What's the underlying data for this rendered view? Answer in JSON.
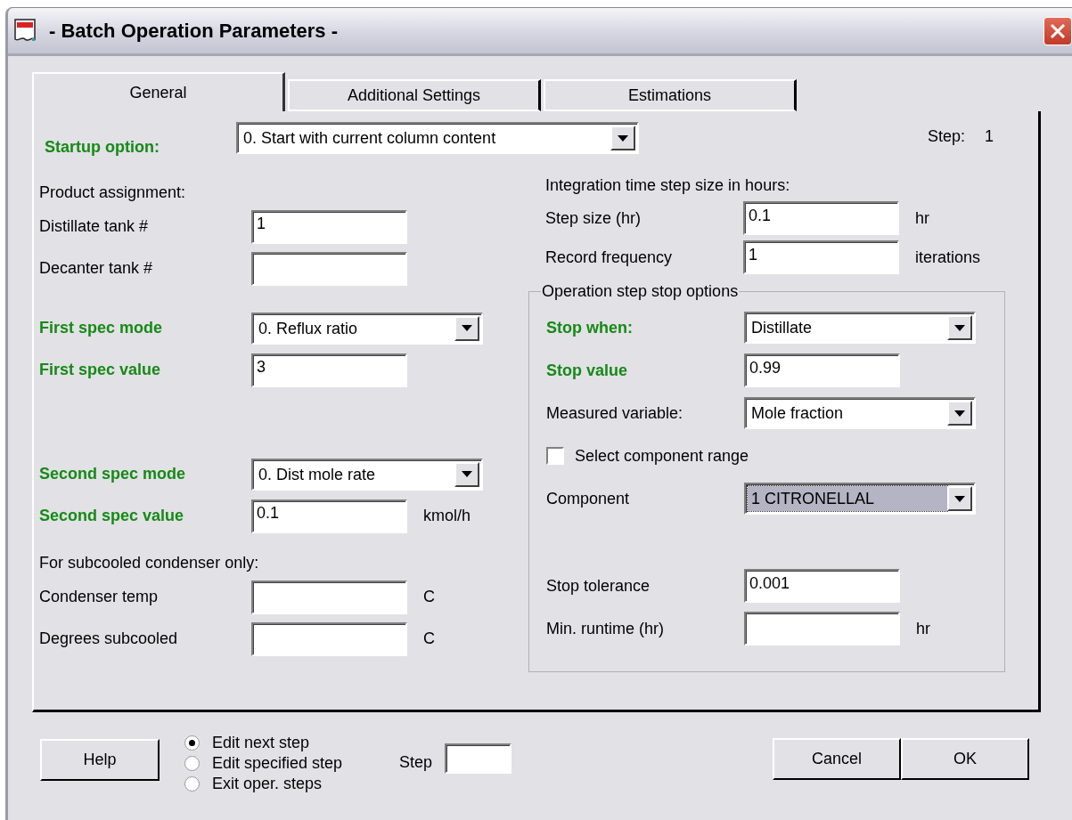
{
  "window": {
    "title": "- Batch Operation Parameters  -"
  },
  "tabs": [
    {
      "label": "General",
      "selected": true
    },
    {
      "label": "Additional Settings",
      "selected": false
    },
    {
      "label": "Estimations",
      "selected": false
    }
  ],
  "startup": {
    "label": "Startup option:",
    "value": "0. Start with current column content",
    "emphasized": true
  },
  "step_indicator": {
    "label": "Step:",
    "value": "1"
  },
  "left_groups": [
    {
      "heading": "Product assignment:",
      "rows": [
        {
          "kind": "field",
          "label": "Distillate tank #",
          "value": "1",
          "emphasized": false
        },
        {
          "kind": "field",
          "label": "Decanter tank #",
          "emphasized": false
        }
      ]
    },
    {
      "rows": [
        {
          "kind": "dropdown",
          "label": "First spec mode",
          "value": "0.  Reflux ratio",
          "emphasized": true,
          "focused": false
        },
        {
          "kind": "field",
          "label": "First spec value",
          "value": "3",
          "emphasized": true
        }
      ]
    },
    {
      "rows": [
        {
          "kind": "dropdown",
          "label": "Second spec mode",
          "value": "0.  Dist mole rate",
          "emphasized": true,
          "focused": false
        },
        {
          "kind": "field",
          "label": "Second spec value",
          "value": "0.1",
          "unit": "kmol/h",
          "emphasized": true
        }
      ]
    },
    {
      "heading": "For subcooled condenser only:",
      "rows": [
        {
          "kind": "field",
          "label": "Condenser temp",
          "unit": "C",
          "emphasized": false
        },
        {
          "kind": "field",
          "label": "Degrees subcooled",
          "unit": "C",
          "emphasized": false
        }
      ]
    }
  ],
  "integration": {
    "heading": "Integration time step size in hours:",
    "rows": [
      {
        "kind": "field",
        "label": "Step size (hr)",
        "value": "0.1",
        "unit": "hr",
        "emphasized": false
      },
      {
        "kind": "field",
        "label": "Record frequency",
        "value": "1",
        "unit": "iterations",
        "emphasized": false
      }
    ]
  },
  "stop_options": {
    "title": "Operation step stop options",
    "rows": [
      {
        "kind": "dropdown",
        "label": "Stop when:",
        "value": "Distillate",
        "emphasized": true,
        "focused": false
      },
      {
        "kind": "field",
        "label": "Stop value",
        "value": "0.99",
        "emphasized": true
      },
      {
        "kind": "dropdown",
        "label": "Measured variable:",
        "value": "Mole fraction",
        "emphasized": false,
        "focused": false
      },
      {
        "kind": "checkbox",
        "label": "Select component range",
        "checked": false
      },
      {
        "kind": "dropdown",
        "label": "Component",
        "value": "1 CITRONELLAL",
        "emphasized": false,
        "focused": true
      },
      {
        "kind": "field",
        "label": "Stop tolerance",
        "value": "0.001",
        "emphasized": false
      },
      {
        "kind": "field",
        "label": "Min. runtime (hr)",
        "unit": "hr",
        "emphasized": false
      }
    ]
  },
  "bottom": {
    "help_button": "Help",
    "radios": [
      {
        "label": "Edit next step",
        "selected": true
      },
      {
        "label": "Edit specified step",
        "selected": false
      },
      {
        "label": "Exit oper. steps",
        "selected": false
      }
    ],
    "step_field": {
      "label": "Step"
    },
    "buttons": [
      "Cancel",
      "OK"
    ]
  }
}
